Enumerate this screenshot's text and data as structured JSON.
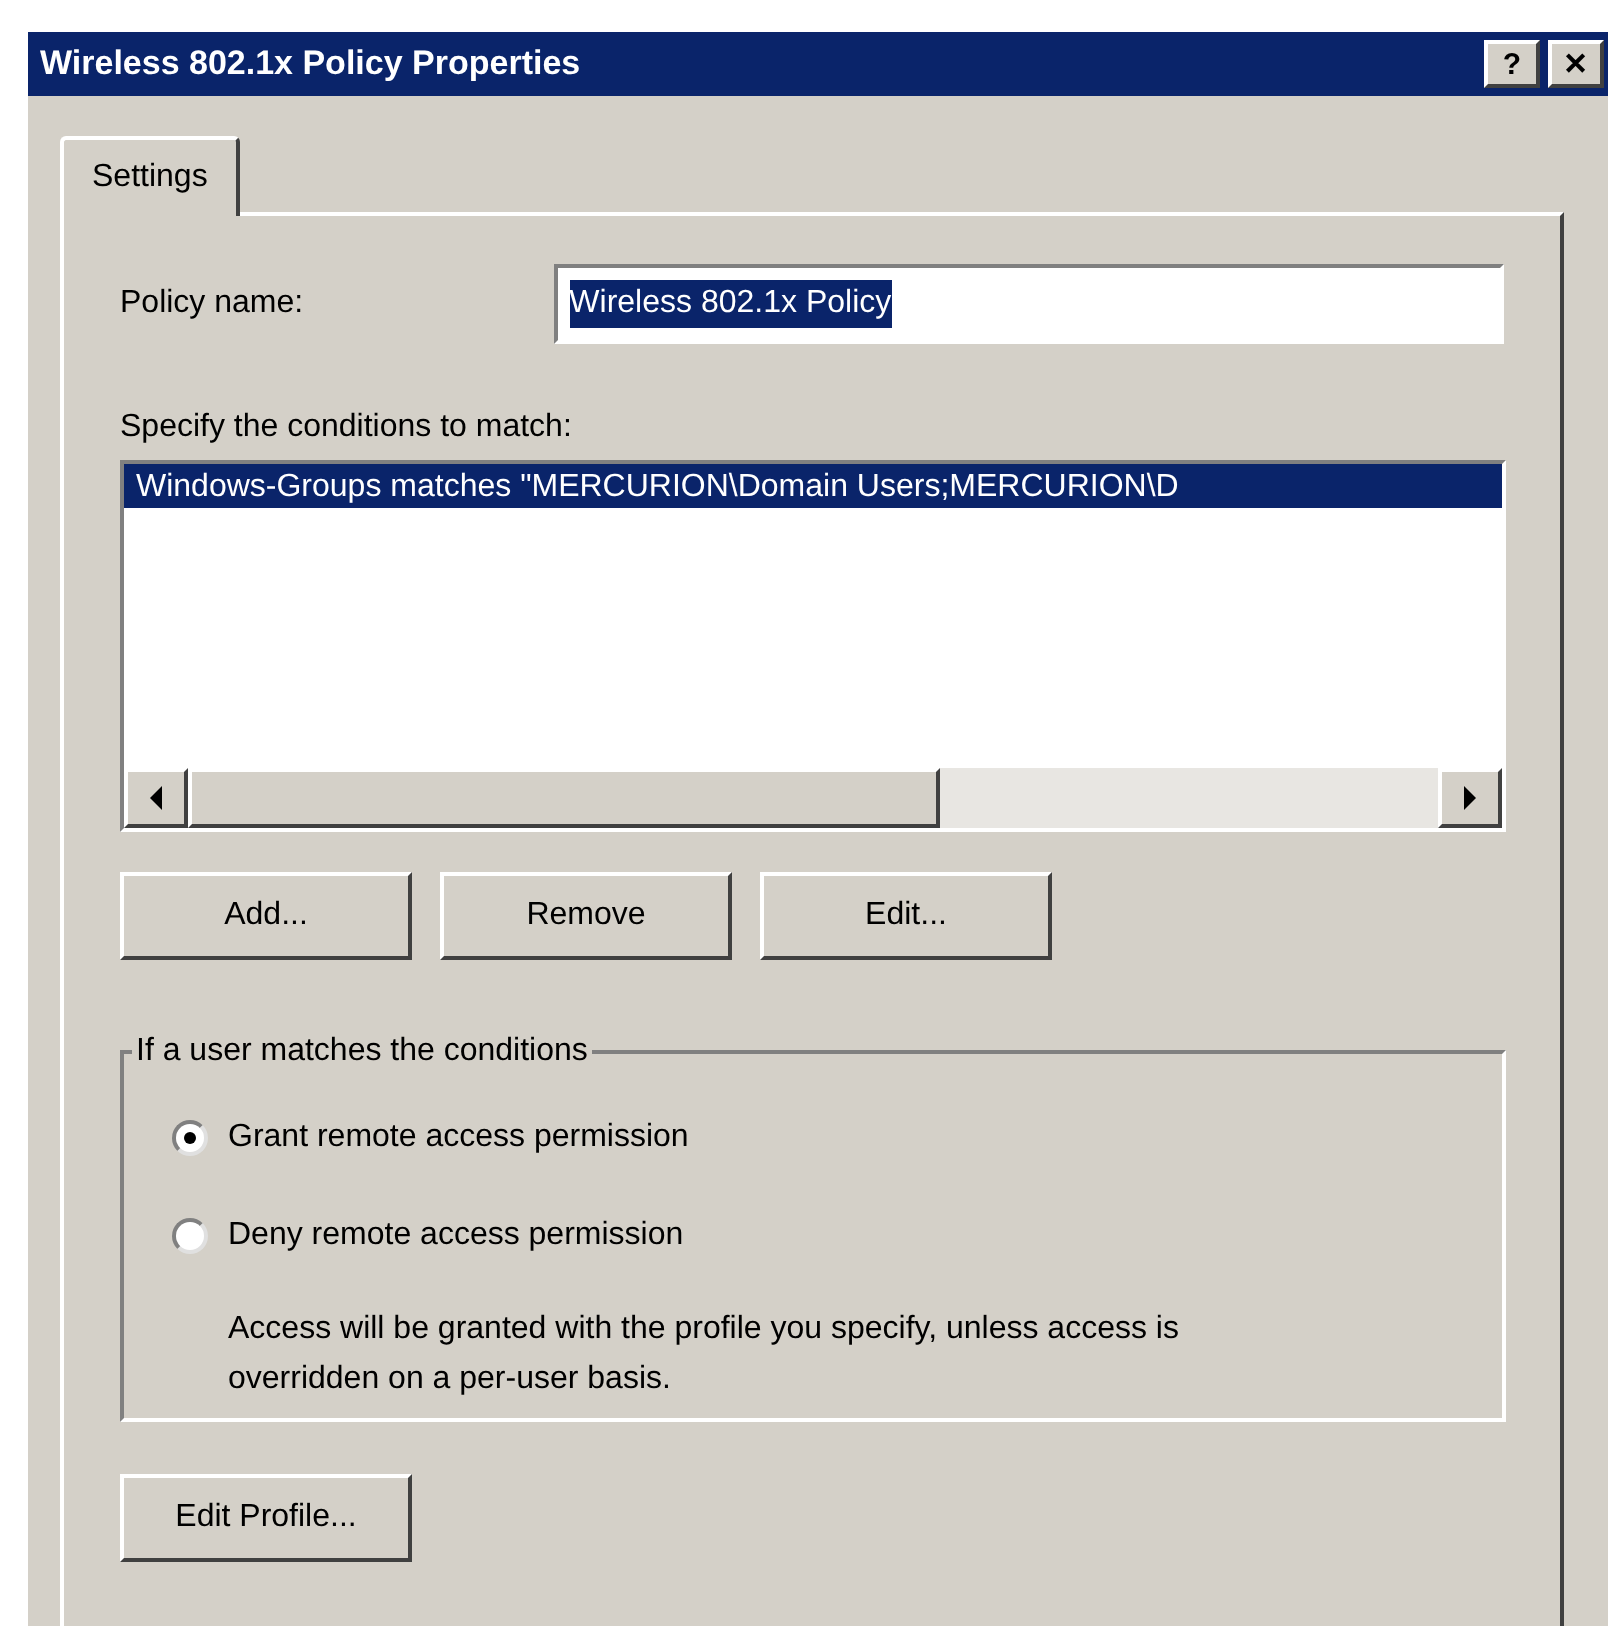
{
  "window": {
    "title": "Wireless 802.1x Policy Properties",
    "help_button": "?",
    "close_button": "✕"
  },
  "tabs": [
    {
      "label": "Settings",
      "selected": true
    }
  ],
  "policy_name": {
    "label": "Policy name:",
    "value": "Wireless 802.1x Policy"
  },
  "conditions": {
    "label": "Specify the conditions to match:",
    "items": [
      {
        "text": "Windows-Groups matches \"MERCURION\\Domain Users;MERCURION\\D",
        "selected": true
      }
    ]
  },
  "condition_buttons": [
    "Add...",
    "Remove",
    "Edit..."
  ],
  "group": {
    "legend": "If a user matches the conditions",
    "options": [
      {
        "label": "Grant remote access permission",
        "selected": true
      },
      {
        "label": "Deny remote access permission",
        "selected": false
      }
    ],
    "note": "Access will be granted with the profile you specify, unless access is overridden on a per-user basis."
  },
  "profile_button": "Edit Profile..."
}
